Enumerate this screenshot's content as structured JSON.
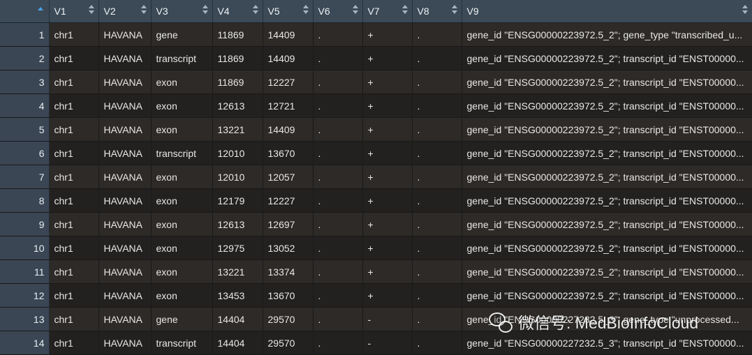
{
  "table": {
    "columns": [
      {
        "label": "",
        "sortable": true
      },
      {
        "label": "V1"
      },
      {
        "label": "V2"
      },
      {
        "label": "V3"
      },
      {
        "label": "V4"
      },
      {
        "label": "V5"
      },
      {
        "label": "V6"
      },
      {
        "label": "V7"
      },
      {
        "label": "V8"
      },
      {
        "label": "V9"
      }
    ],
    "rows": [
      [
        "1",
        "chr1",
        "HAVANA",
        "gene",
        "11869",
        "14409",
        ".",
        "+",
        ".",
        "gene_id \"ENSG00000223972.5_2\"; gene_type \"transcribed_u..."
      ],
      [
        "2",
        "chr1",
        "HAVANA",
        "transcript",
        "11869",
        "14409",
        ".",
        "+",
        ".",
        "gene_id \"ENSG00000223972.5_2\"; transcript_id \"ENST00000..."
      ],
      [
        "3",
        "chr1",
        "HAVANA",
        "exon",
        "11869",
        "12227",
        ".",
        "+",
        ".",
        "gene_id \"ENSG00000223972.5_2\"; transcript_id \"ENST00000..."
      ],
      [
        "4",
        "chr1",
        "HAVANA",
        "exon",
        "12613",
        "12721",
        ".",
        "+",
        ".",
        "gene_id \"ENSG00000223972.5_2\"; transcript_id \"ENST00000..."
      ],
      [
        "5",
        "chr1",
        "HAVANA",
        "exon",
        "13221",
        "14409",
        ".",
        "+",
        ".",
        "gene_id \"ENSG00000223972.5_2\"; transcript_id \"ENST00000..."
      ],
      [
        "6",
        "chr1",
        "HAVANA",
        "transcript",
        "12010",
        "13670",
        ".",
        "+",
        ".",
        "gene_id \"ENSG00000223972.5_2\"; transcript_id \"ENST00000..."
      ],
      [
        "7",
        "chr1",
        "HAVANA",
        "exon",
        "12010",
        "12057",
        ".",
        "+",
        ".",
        "gene_id \"ENSG00000223972.5_2\"; transcript_id \"ENST00000..."
      ],
      [
        "8",
        "chr1",
        "HAVANA",
        "exon",
        "12179",
        "12227",
        ".",
        "+",
        ".",
        "gene_id \"ENSG00000223972.5_2\"; transcript_id \"ENST00000..."
      ],
      [
        "9",
        "chr1",
        "HAVANA",
        "exon",
        "12613",
        "12697",
        ".",
        "+",
        ".",
        "gene_id \"ENSG00000223972.5_2\"; transcript_id \"ENST00000..."
      ],
      [
        "10",
        "chr1",
        "HAVANA",
        "exon",
        "12975",
        "13052",
        ".",
        "+",
        ".",
        "gene_id \"ENSG00000223972.5_2\"; transcript_id \"ENST00000..."
      ],
      [
        "11",
        "chr1",
        "HAVANA",
        "exon",
        "13221",
        "13374",
        ".",
        "+",
        ".",
        "gene_id \"ENSG00000223972.5_2\"; transcript_id \"ENST00000..."
      ],
      [
        "12",
        "chr1",
        "HAVANA",
        "exon",
        "13453",
        "13670",
        ".",
        "+",
        ".",
        "gene_id \"ENSG00000223972.5_2\"; transcript_id \"ENST00000..."
      ],
      [
        "13",
        "chr1",
        "HAVANA",
        "gene",
        "14404",
        "29570",
        ".",
        "-",
        ".",
        "gene_id \"ENSG00000227232.5_3\"; gene_type \"unprocessed..."
      ],
      [
        "14",
        "chr1",
        "HAVANA",
        "transcript",
        "14404",
        "29570",
        ".",
        "-",
        ".",
        "gene_id \"ENSG00000227232.5_3\"; transcript_id \"ENST00000..."
      ]
    ]
  },
  "watermark": {
    "text": "微信号: MedBioInfoCloud",
    "icon": "wechat-icon"
  },
  "colors": {
    "header_bg": "#3c4a57",
    "rownum_bg": "#3a4654",
    "row_odd": "#2d2a27",
    "row_even": "#232120",
    "sort_accent": "#4aa3e8"
  }
}
